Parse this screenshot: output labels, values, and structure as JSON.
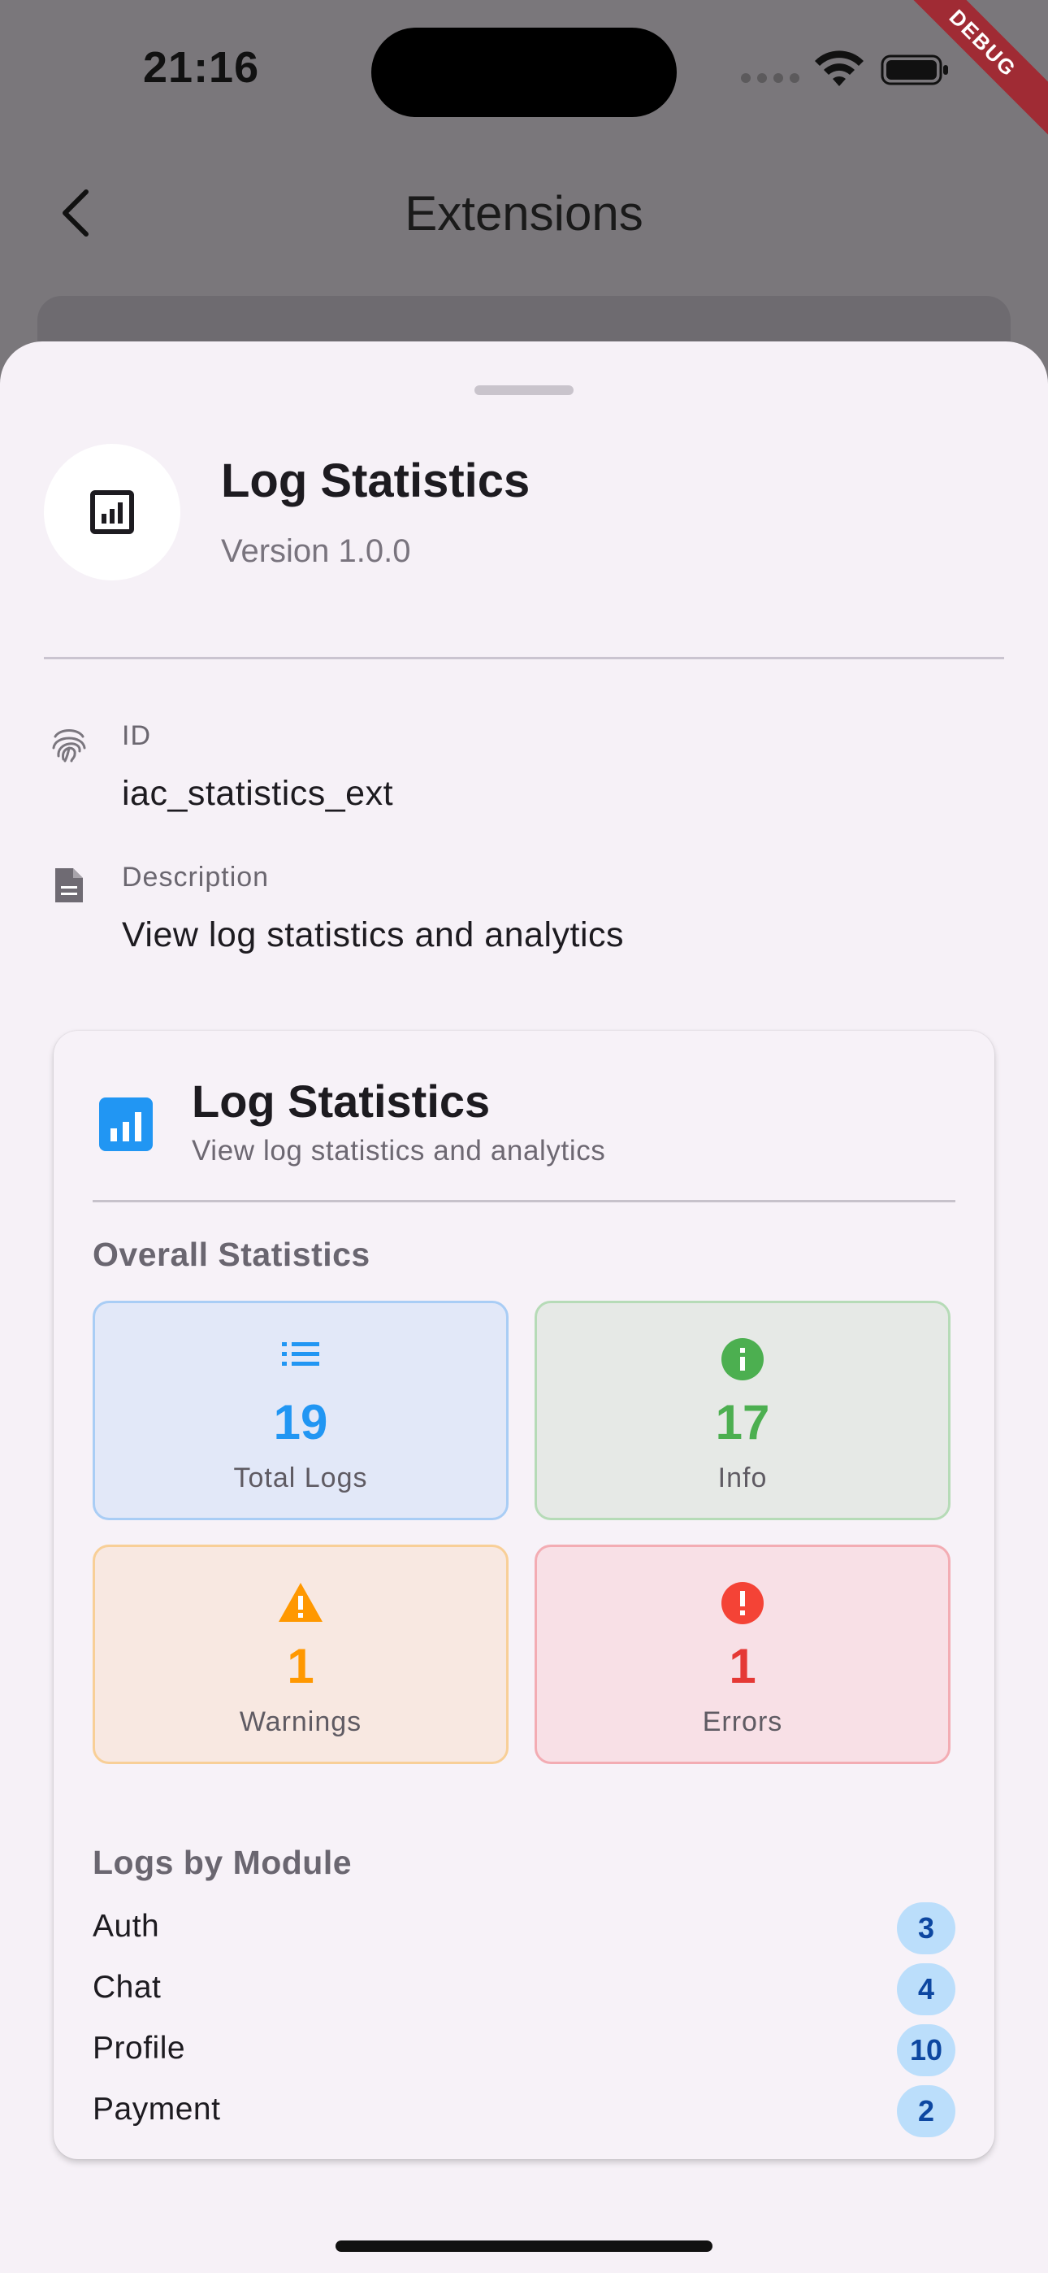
{
  "status_bar": {
    "time": "21:16",
    "debug_label": "DEBUG"
  },
  "app_bar": {
    "title": "Extensions",
    "back_icon": "chevron-left-icon"
  },
  "extension": {
    "icon": "bar-chart-icon",
    "name": "Log Statistics",
    "version": "Version 1.0.0",
    "id_label": "ID",
    "id_value": "iac_statistics_ext",
    "id_icon": "fingerprint-icon",
    "description_label": "Description",
    "description_value": "View log statistics and analytics",
    "description_icon": "document-icon"
  },
  "stats_card": {
    "icon": "bar-chart-icon",
    "title": "Log Statistics",
    "subtitle": "View log statistics and analytics",
    "overall_heading": "Overall Statistics",
    "tiles": [
      {
        "label": "Total Logs",
        "value": "19",
        "icon": "list-icon",
        "color": "#2196f3"
      },
      {
        "label": "Info",
        "value": "17",
        "icon": "info-icon",
        "color": "#4caf50"
      },
      {
        "label": "Warnings",
        "value": "1",
        "icon": "warning-icon",
        "color": "#ff9800"
      },
      {
        "label": "Errors",
        "value": "1",
        "icon": "error-icon",
        "color": "#f44336"
      }
    ],
    "modules_heading": "Logs by Module",
    "modules": [
      {
        "name": "Auth",
        "count": "3"
      },
      {
        "name": "Chat",
        "count": "4"
      },
      {
        "name": "Profile",
        "count": "10"
      },
      {
        "name": "Payment",
        "count": "2"
      }
    ]
  }
}
